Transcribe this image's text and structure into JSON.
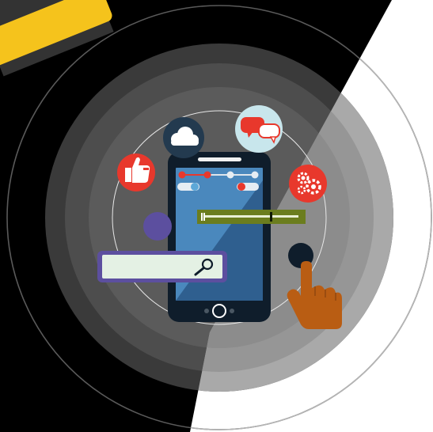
{
  "illustration": {
    "subject": "smartphone-app-interface",
    "icons": [
      "cloud-icon",
      "chat-bubbles-icon",
      "thumbs-up-icon",
      "gears-icon",
      "search-icon",
      "pointing-hand-icon"
    ],
    "colors": {
      "background_dark": "#000000",
      "background_light": "#ffffff",
      "ring_outer": "#3a3a3a",
      "ring_mid": "#4d4d4d",
      "ring_inner": "#5b5b5b",
      "light_ring_outer": "#a9a9a9",
      "light_ring_inner": "#8c8c8c",
      "accent_yellow": "#f5c31c",
      "accent_red": "#e8382c",
      "accent_purple": "#5c4f9f",
      "accent_olive": "#6b7d1e",
      "phone_body": "#0f1d2b",
      "screen_blue": "#3f7bb0",
      "hand_orange": "#b95d13",
      "cloud_badge": "#233a4f",
      "chat_badge": "#c8e6ec"
    }
  }
}
